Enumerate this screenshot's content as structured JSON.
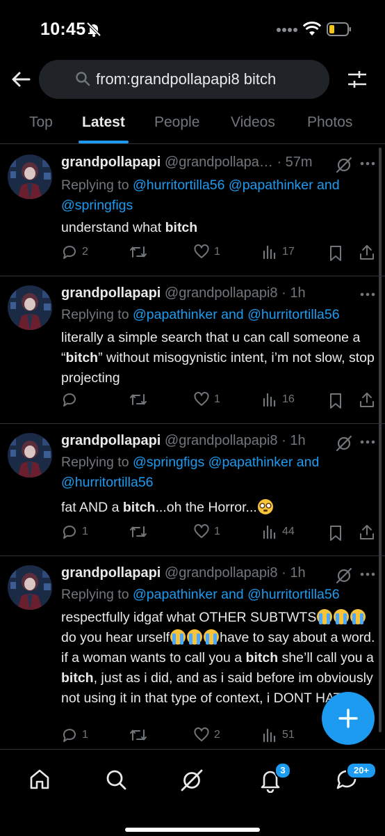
{
  "status_bar": {
    "time": "10:45"
  },
  "search": {
    "query": "from:grandpollapapi8 bitch"
  },
  "tabs": [
    {
      "label": "Top"
    },
    {
      "label": "Latest",
      "active": true
    },
    {
      "label": "People"
    },
    {
      "label": "Videos"
    },
    {
      "label": "Photos"
    }
  ],
  "tweets": [
    {
      "name": "grandpollapapi",
      "handle": "@grandpollapa…",
      "dot": "·",
      "time": "57m",
      "replying_prefix": "Replying to ",
      "mention1": "@hurritortilla56",
      "mention2": "@papathinker",
      "and": " and",
      "mention3": "@springfigs",
      "text_pre": "understand what ",
      "bold1": "bitch",
      "replies": "2",
      "retweets": "",
      "likes": "1",
      "views": "17"
    },
    {
      "name": "grandpollapapi",
      "handle": "@grandpollapapi8",
      "dot": "·",
      "time": "1h",
      "replying_prefix": "Replying to ",
      "mention1": "@papathinker",
      "and": " and ",
      "mention2": "@hurritortilla56",
      "text_pre": "literally a simple search that u can call someone a “",
      "bold1": "bitch",
      "text_post": "” without misogynistic intent, i’m not slow, stop projecting",
      "replies": "",
      "retweets": "",
      "likes": "1",
      "views": "16"
    },
    {
      "name": "grandpollapapi",
      "handle": "@grandpollapapi8",
      "dot": "·",
      "time": "1h",
      "replying_prefix": "Replying to ",
      "mention1": "@springfigs",
      "mention2": "@papathinker",
      "and": " and",
      "mention3": "@hurritortilla56",
      "text_pre": "fat AND a ",
      "bold1": "bitch",
      "text_post": "...oh the Horror...",
      "replies": "1",
      "retweets": "",
      "likes": "1",
      "views": "44"
    },
    {
      "name": "grandpollapapi",
      "handle": "@grandpollapapi8",
      "dot": "·",
      "time": "1h",
      "replying_prefix": "Replying to ",
      "mention1": "@papathinker",
      "and": " and ",
      "mention2": "@hurritortilla56",
      "text_pre": "respectfully idgaf what OTHER SUBTWTS",
      "text_mid1": "do you hear urself",
      "text_mid2": "have to say about a word. if a woman wants to call you a ",
      "bold1": "bitch",
      "text_mid3": " she’ll call you a ",
      "bold2": "bitch",
      "text_post": ", just as i did, and as i said before im obviously not using it in that type of context, i DONT HATE WOMEN",
      "replies": "1",
      "retweets": "",
      "likes": "2",
      "views": "51"
    }
  ],
  "nav": {
    "notifications_badge": "3",
    "messages_badge": "20+"
  },
  "colors": {
    "background": "#000000",
    "accent": "#1d9bf0",
    "secondary_text": "#71767b",
    "divider": "#2f3336"
  },
  "icons": [
    "back-arrow-icon",
    "search-icon",
    "filter-sliders-icon",
    "grok-icon",
    "more-icon",
    "reply-icon",
    "retweet-icon",
    "like-icon",
    "views-icon",
    "bookmark-icon",
    "share-icon",
    "compose-plus-icon",
    "home-icon",
    "explore-icon",
    "notifications-bell-icon",
    "messages-icon"
  ]
}
